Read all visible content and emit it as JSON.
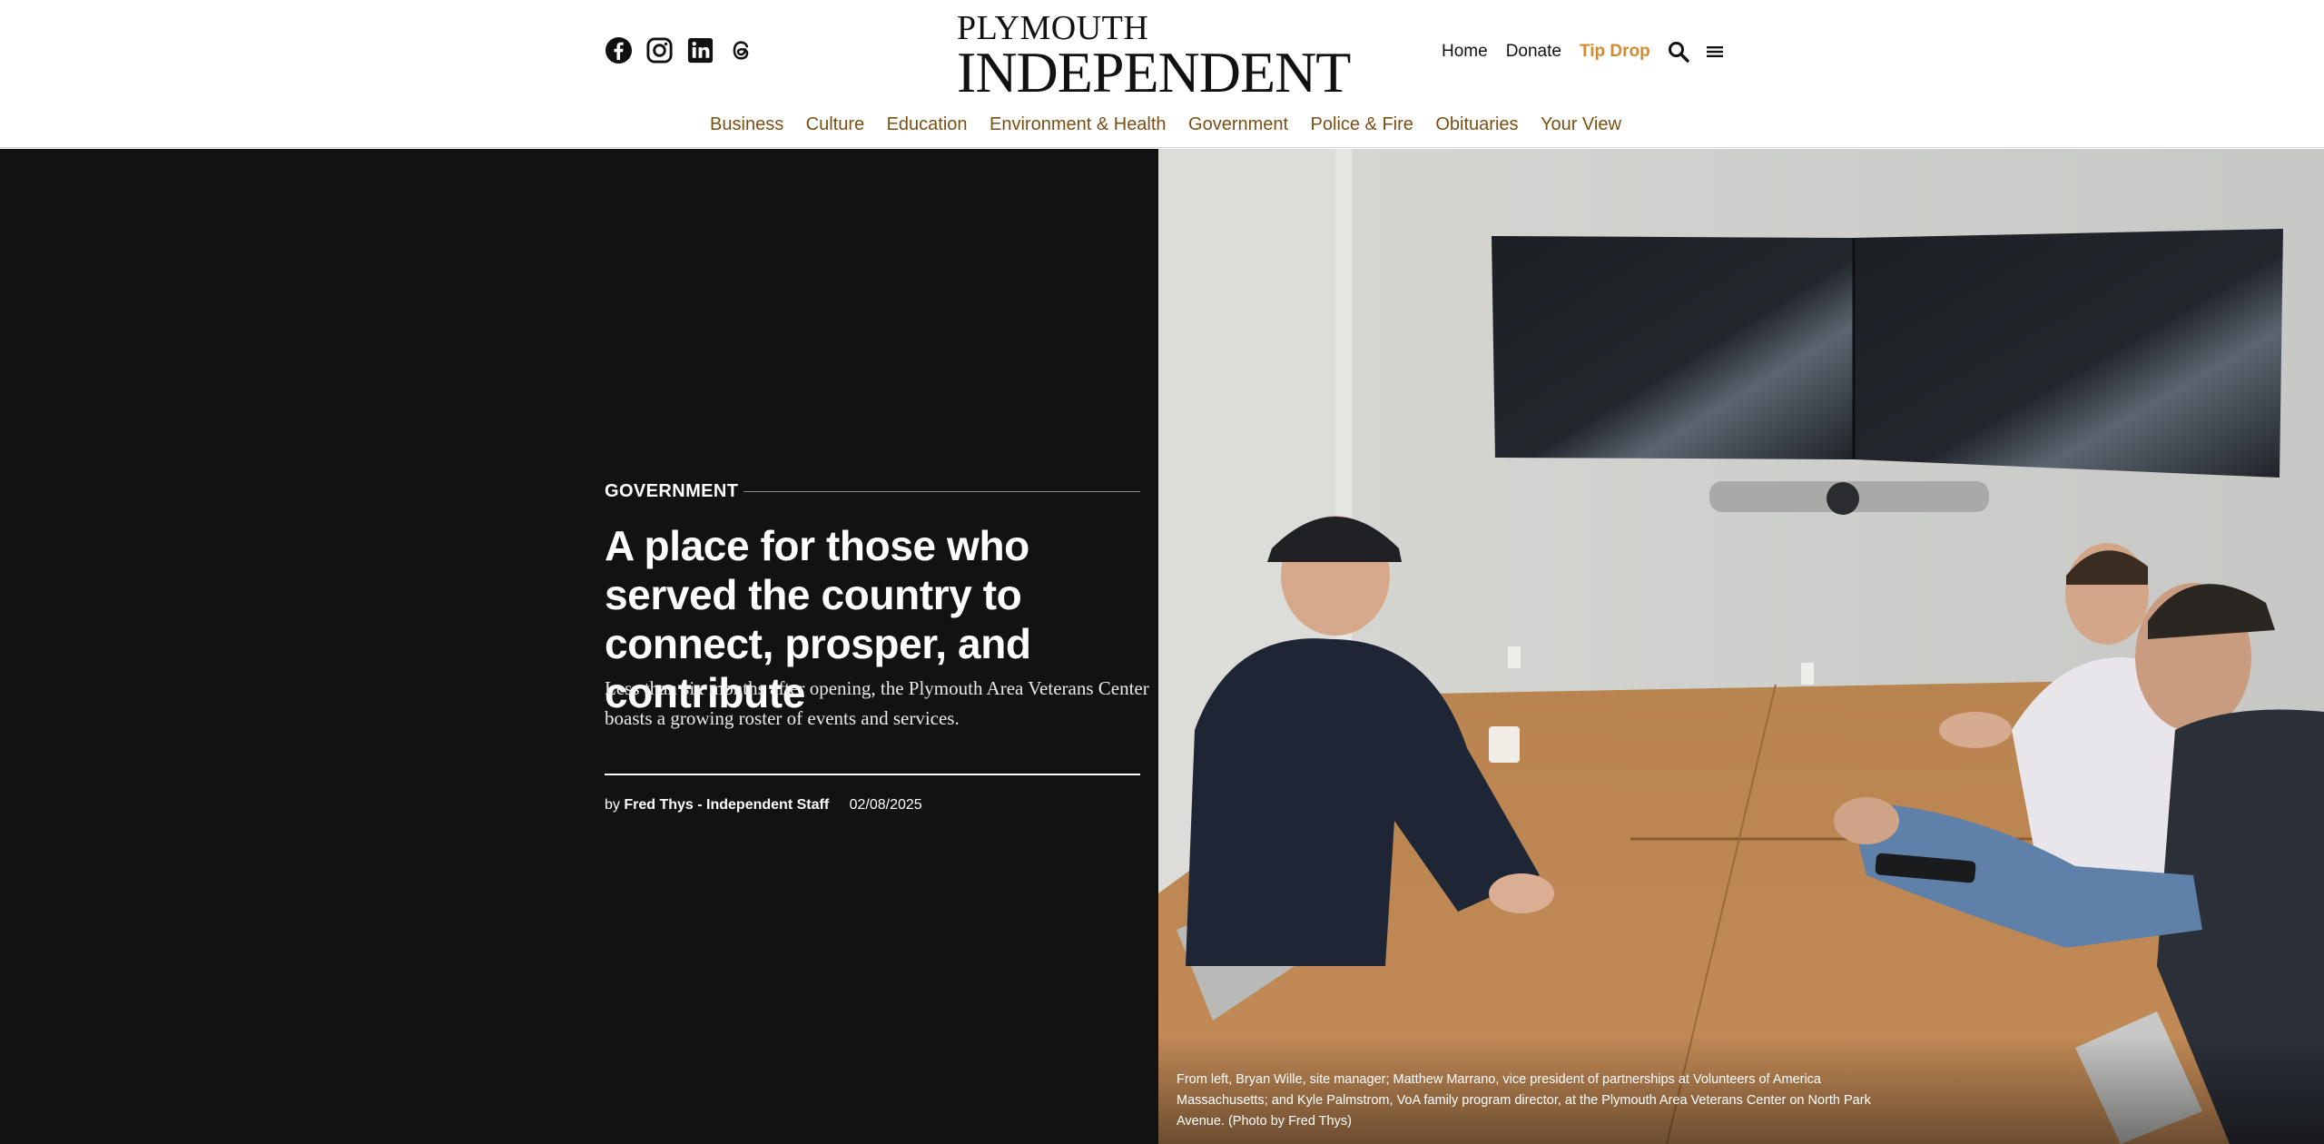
{
  "header": {
    "social": [
      {
        "name": "Facebook",
        "icon": "facebook-icon"
      },
      {
        "name": "Instagram",
        "icon": "instagram-icon"
      },
      {
        "name": "LinkedIn",
        "icon": "linkedin-icon"
      },
      {
        "name": "Threads",
        "icon": "threads-icon"
      }
    ],
    "logo": {
      "top": "PLYMOUTH",
      "main": "INDEPENDENT"
    },
    "utility": {
      "home": "Home",
      "donate": "Donate",
      "tip_drop": "Tip Drop",
      "search_icon": "search-icon",
      "menu_icon": "hamburger-menu-icon"
    },
    "sections": [
      "Business",
      "Culture",
      "Education",
      "Environment & Health",
      "Government",
      "Police & Fire",
      "Obituaries",
      "Your View"
    ]
  },
  "article": {
    "category": "GOVERNMENT",
    "headline": "A place for those who served the country to connect, prosper, and contribute",
    "dek": "Less than six months after opening, the Plymouth Area Veterans Center boasts a growing roster of events and services.",
    "byline_prefix": "by",
    "author": "Fred Thys - Independent Staff",
    "date": "02/08/2025",
    "caption": "From left, Bryan Wille, site manager; Matthew Marrano, vice president of partnerships at Volunteers of America Massachusetts; and Kyle Palmstrom, VoA family program director, at the Plymouth Area Veterans Center on North Park Avenue. (Photo by Fred Thys)"
  },
  "colors": {
    "accent_tip": "#d38a2f",
    "section_nav": "#7a4f14",
    "hero_bg": "#121212"
  }
}
